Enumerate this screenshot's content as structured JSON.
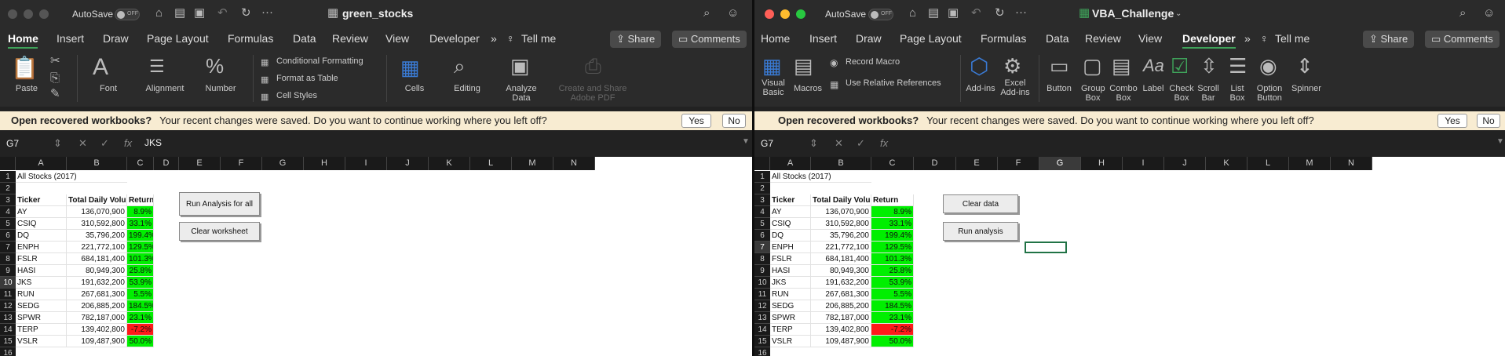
{
  "left": {
    "autosave_label": "AutoSave",
    "toggle_label": "OFF",
    "title": "green_stocks",
    "tabs": [
      "Home",
      "Insert",
      "Draw",
      "Page Layout",
      "Formulas",
      "Data",
      "Review",
      "View",
      "Developer"
    ],
    "active_tab": "Home",
    "tell_me": "Tell me",
    "share_label": "Share",
    "comments_label": "Comments",
    "ribbon": {
      "paste": "Paste",
      "font": "Font",
      "alignment": "Alignment",
      "number": "Number",
      "conditional_formatting": "Conditional Formatting",
      "format_as_table": "Format as Table",
      "cell_styles": "Cell Styles",
      "cells": "Cells",
      "editing": "Editing",
      "analyze_data": "Analyze Data",
      "create_share_pdf": "Create and Share Adobe PDF"
    },
    "name_box": "G7",
    "formula_value": "JKS",
    "buttons": [
      "Run Analysis for all stocks",
      "Clear worksheet"
    ],
    "selected_row": "10"
  },
  "right": {
    "autosave_label": "AutoSave",
    "toggle_label": "OFF",
    "title": "VBA_Challenge",
    "tabs": [
      "Home",
      "Insert",
      "Draw",
      "Page Layout",
      "Formulas",
      "Data",
      "Review",
      "View",
      "Developer"
    ],
    "active_tab": "Developer",
    "tell_me": "Tell me",
    "share_label": "Share",
    "comments_label": "Comments",
    "ribbon": {
      "visual_basic": "Visual Basic",
      "macros": "Macros",
      "record_macro": "Record Macro",
      "use_relative_references": "Use Relative References",
      "add_ins": "Add-ins",
      "excel_add_ins": "Excel Add-ins",
      "button": "Button",
      "group_box": "Group Box",
      "combo_box": "Combo Box",
      "label": "Label",
      "check_box": "Check Box",
      "scroll_bar": "Scroll Bar",
      "list_box": "List Box",
      "option_button": "Option Button",
      "spinner": "Spinner"
    },
    "name_box": "G7",
    "formula_value": "",
    "buttons": [
      "Clear data",
      "Run analysis"
    ],
    "selected_row": "7"
  },
  "recovery": {
    "title": "Open recovered workbooks?",
    "message": "Your recent changes were saved. Do you want to continue working where you left off?",
    "yes": "Yes",
    "no": "No"
  },
  "columns": [
    "A",
    "B",
    "C",
    "D",
    "E",
    "F",
    "G",
    "H",
    "I",
    "J",
    "K",
    "L",
    "M",
    "N"
  ],
  "rows": [
    "1",
    "2",
    "3",
    "4",
    "5",
    "6",
    "7",
    "8",
    "9",
    "10",
    "11",
    "12",
    "13",
    "14",
    "15",
    "16"
  ],
  "sheet": {
    "title": "All Stocks (2017)",
    "headers": [
      "Ticker",
      "Total Daily Volume",
      "Return"
    ],
    "data": [
      {
        "ticker": "AY",
        "volume": "136,070,900",
        "ret": "8.9%",
        "status": "positive"
      },
      {
        "ticker": "CSIQ",
        "volume": "310,592,800",
        "ret": "33.1%",
        "status": "positive"
      },
      {
        "ticker": "DQ",
        "volume": "35,796,200",
        "ret": "199.4%",
        "status": "positive"
      },
      {
        "ticker": "ENPH",
        "volume": "221,772,100",
        "ret": "129.5%",
        "status": "positive"
      },
      {
        "ticker": "FSLR",
        "volume": "684,181,400",
        "ret": "101.3%",
        "status": "positive"
      },
      {
        "ticker": "HASI",
        "volume": "80,949,300",
        "ret": "25.8%",
        "status": "positive"
      },
      {
        "ticker": "JKS",
        "volume": "191,632,200",
        "ret": "53.9%",
        "status": "positive"
      },
      {
        "ticker": "RUN",
        "volume": "267,681,300",
        "ret": "5.5%",
        "status": "positive"
      },
      {
        "ticker": "SEDG",
        "volume": "206,885,200",
        "ret": "184.5%",
        "status": "positive"
      },
      {
        "ticker": "SPWR",
        "volume": "782,187,000",
        "ret": "23.1%",
        "status": "positive"
      },
      {
        "ticker": "TERP",
        "volume": "139,402,800",
        "ret": "-7.2%",
        "status": "negative"
      },
      {
        "ticker": "VSLR",
        "volume": "109,487,900",
        "ret": "50.0%",
        "status": "positive"
      }
    ]
  },
  "colors": {
    "positive": "#00ef00",
    "negative": "#ff1a1a",
    "accent": "#217346"
  }
}
